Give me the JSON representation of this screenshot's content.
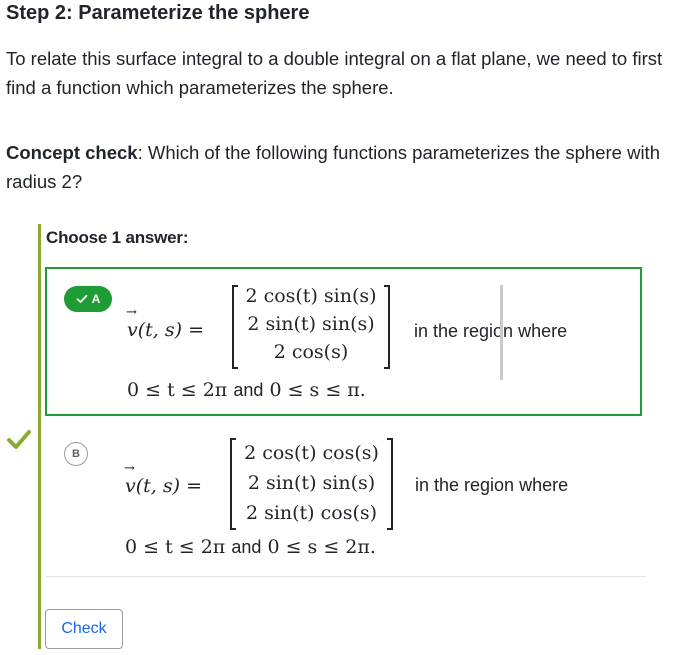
{
  "step_title": "Step 2: Parameterize the sphere",
  "intro": "To relate this surface integral to a double integral on a flat plane, we need to first find a function which parameterizes the sphere.",
  "concept": {
    "label": "Concept check",
    "text": ": Which of the following functions parameterizes the sphere with radius 2?"
  },
  "choose_label": "Choose 1 answer:",
  "choices": [
    {
      "letter": "A",
      "selected": true,
      "lhs": "v(t, s) =",
      "rows": [
        "2 cos(t) sin(s)",
        "2 sin(t) sin(s)",
        "2 cos(s)"
      ],
      "region_text": "in the region where",
      "constraint_left": "0 ≤ t ≤ 2π",
      "constraint_and": "and",
      "constraint_right": "0 ≤ s ≤ π."
    },
    {
      "letter": "B",
      "selected": false,
      "lhs": "v(t, s) =",
      "rows": [
        "2 cos(t) cos(s)",
        "2 sin(t) sin(s)",
        "2 sin(t) cos(s)"
      ],
      "region_text": "in the region where",
      "constraint_left": "0 ≤ t ≤ 2π",
      "constraint_and": "and",
      "constraint_right": "0 ≤ s ≤ 2π."
    }
  ],
  "check_button": "Check",
  "colors": {
    "selected": "#1f9c36",
    "link": "#1865f2",
    "rail": "#8bab2f"
  },
  "icons": {
    "correct": "checkmark-icon",
    "selected_mark": "check-icon"
  }
}
